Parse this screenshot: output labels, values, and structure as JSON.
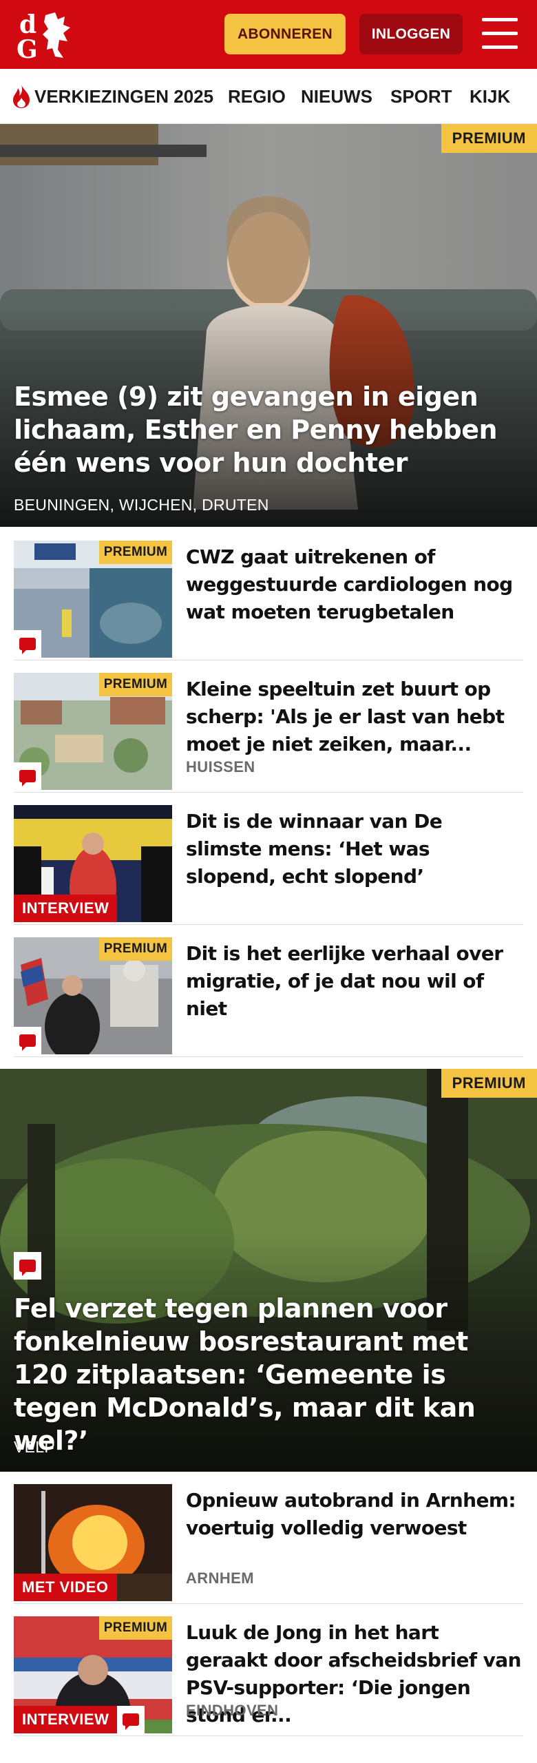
{
  "header": {
    "subscribe_label": "ABONNEREN",
    "login_label": "INLOGGEN",
    "logo_icon": "dg-logo-icon",
    "menu_icon": "hamburger-menu-icon",
    "brand_color": "#d10a11",
    "accent_color": "#f5c342"
  },
  "nav": {
    "items": [
      {
        "label": "VERKIEZINGEN 2025",
        "icon": "flame-icon"
      },
      {
        "label": "REGIO"
      },
      {
        "label": "NIEUWS"
      },
      {
        "label": "SPORT"
      },
      {
        "label": "KIJK"
      }
    ]
  },
  "hero1": {
    "badge": "PREMIUM",
    "title": "Esmee (9) zit gevangen in eigen lichaam, Esther en Penny hebben één wens voor hun dochter",
    "location": "BEUNINGEN, WIJCHEN, DRUTEN"
  },
  "list1": [
    {
      "badge": "PREMIUM",
      "title": "CWZ gaat uitrekenen of weggestuurde cardiologen nog wat moeten terugbetalen",
      "location": "",
      "label": "",
      "comment_icon": "comment-icon"
    },
    {
      "badge": "PREMIUM",
      "title": "Kleine speeltuin zet buurt op scherp: 'Als je er last van hebt moet je niet zeiken, maar...",
      "location": "HUISSEN",
      "label": "",
      "comment_icon": "comment-icon"
    },
    {
      "badge": "",
      "title": "Dit is de winnaar van De slimste mens: ‘Het was slopend, echt slopend’",
      "location": "",
      "label": "INTERVIEW"
    },
    {
      "badge": "PREMIUM",
      "title": "Dit is het eerlijke verhaal over migratie, of je dat nou wil of niet",
      "location": "",
      "label": "",
      "comment_icon": "comment-icon"
    }
  ],
  "hero2": {
    "badge": "PREMIUM",
    "title": "Fel verzet tegen plannen voor fonkel­nieuw bosrestaurant met 120 zitplaat­sen: ‘Gemeente is tegen McDonald’s, maar dit kan wel?’",
    "location": "VELP",
    "comment_icon": "comment-icon"
  },
  "list2": [
    {
      "badge": "",
      "title": "Opnieuw autobrand in Arnhem: voertuig volledig verwoest",
      "location": "ARNHEM",
      "label": "MET VIDEO"
    },
    {
      "badge": "PREMIUM",
      "title": "Luuk de Jong in het hart geraakt door afscheidsbrief van PSV-supporter: ‘Die jongen stond er...",
      "location": "EINDHOVEN",
      "label": "INTERVIEW",
      "comment_icon": "comment-icon"
    }
  ]
}
